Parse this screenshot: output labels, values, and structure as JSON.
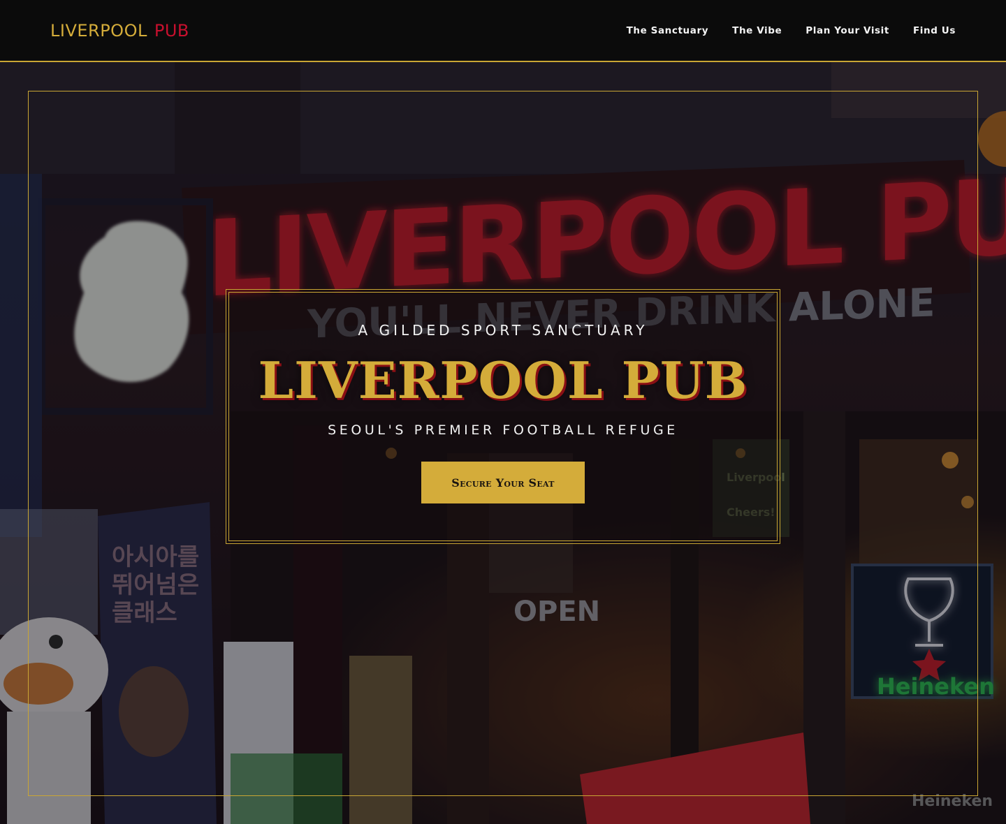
{
  "brand": {
    "part1": "LIVERPOOL",
    "part2": "PUB"
  },
  "nav": {
    "items": [
      {
        "label": "The Sanctuary"
      },
      {
        "label": "The Vibe"
      },
      {
        "label": "Plan Your Visit"
      },
      {
        "label": "Find Us"
      }
    ]
  },
  "hero": {
    "tagline": "A GILDED SPORT SANCTUARY",
    "title": "LIVERPOOL PUB",
    "subtitle": "SEOUL'S PREMIER FOOTBALL REFUGE",
    "cta_label": "Secure Your Seat",
    "photo": {
      "sign_text": "LIVERPOOL PUB",
      "motto_text": "YOU'LL NEVER DRINK ALONE",
      "open_sign": "OPEN",
      "poster_text": [
        "아시아를",
        "뛰어넘은",
        "클래스"
      ],
      "beer_brand": "Heineken",
      "window_text": [
        "Liverpool",
        "Cheers!"
      ]
    }
  },
  "colors": {
    "gold": "#d4ac3a",
    "red": "#c8102e",
    "nav_bg": "#0b0b0b"
  }
}
